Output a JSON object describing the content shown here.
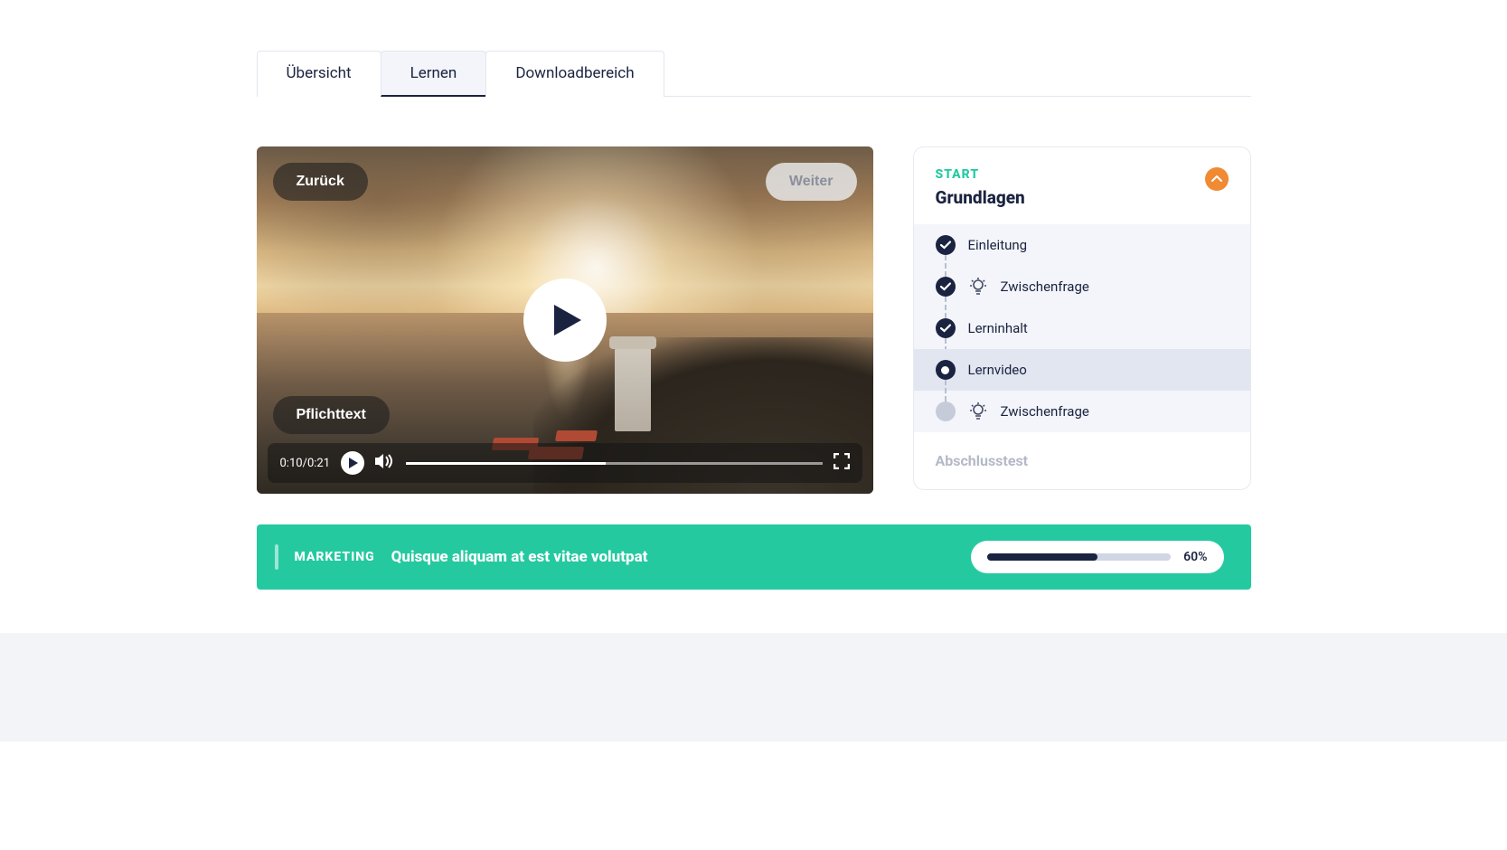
{
  "tabs": [
    {
      "label": "Übersicht",
      "active": false
    },
    {
      "label": "Lernen",
      "active": true
    },
    {
      "label": "Downloadbereich",
      "active": false
    }
  ],
  "video": {
    "back_label": "Zurück",
    "next_label": "Weiter",
    "overlay_label": "Pflichttext",
    "time_current": "0:10",
    "time_total": "0:21",
    "progress_pct": 48
  },
  "sidebar": {
    "eyebrow": "START",
    "title": "Grundlagen",
    "items": [
      {
        "label": "Einleitung",
        "status": "done",
        "type": "plain"
      },
      {
        "label": "Zwischenfrage",
        "status": "done",
        "type": "question"
      },
      {
        "label": "Lerninhalt",
        "status": "done",
        "type": "plain"
      },
      {
        "label": "Lernvideo",
        "status": "current",
        "type": "plain"
      },
      {
        "label": "Zwischenfrage",
        "status": "pending",
        "type": "question"
      }
    ],
    "footer": "Abschlusstest"
  },
  "banner": {
    "category": "MARKETING",
    "title": "Quisque aliquam at est vitae volutpat",
    "progress_pct": 60,
    "progress_label": "60%"
  },
  "colors": {
    "accent_teal": "#25c9a0",
    "accent_orange": "#f08a33",
    "navy": "#1a2340"
  }
}
